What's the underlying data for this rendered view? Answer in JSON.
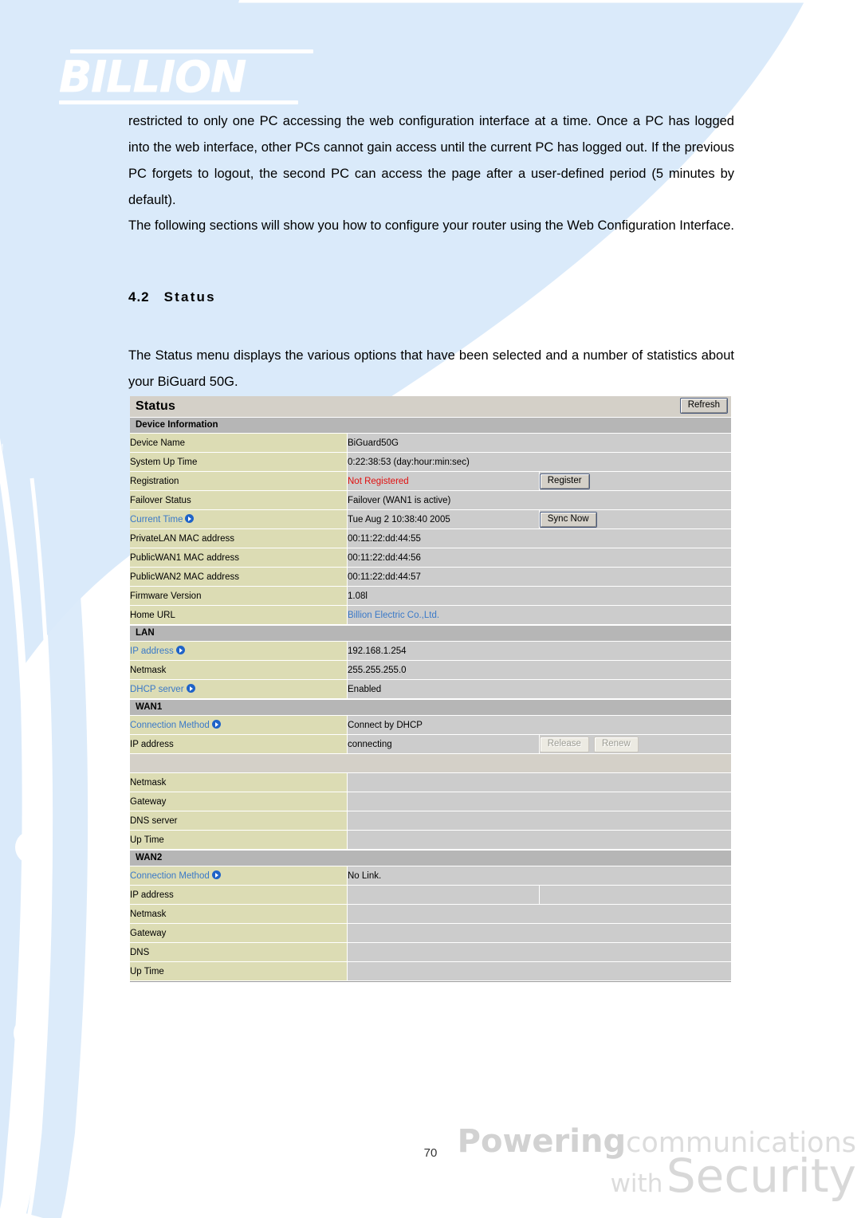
{
  "document": {
    "brand_logo_text": "BILLION",
    "page_number": "70",
    "footer": {
      "powering": "Powering",
      "communications": "communications",
      "with": "with",
      "security": "Security"
    },
    "paragraphs": {
      "p1": "restricted to only one PC accessing the web configuration interface at a time. Once a PC has logged into the web interface, other PCs cannot gain access until the current PC has logged out. If the previous PC forgets to logout, the second PC can access the page after a user-defined period (5 minutes by default).",
      "p2": "The following sections will show you how to configure your router using the Web Configuration Interface.",
      "p3": "The Status menu displays the various options that have been selected and a number of statistics about your BiGuard 50G."
    },
    "heading": {
      "number": "4.2",
      "title": "Status"
    }
  },
  "status_panel": {
    "title": "Status",
    "refresh_label": "Refresh",
    "sections": [
      {
        "name": "Device Information",
        "rows": [
          {
            "label": "Device Name",
            "value": "BiGuard50G"
          },
          {
            "label": "System Up Time",
            "value": "0:22:38:53 (day:hour:min:sec)"
          },
          {
            "label": "Registration",
            "value": "Not Registered",
            "value_style": "red",
            "button": "Register",
            "split": true
          },
          {
            "label": "Failover Status",
            "value": "Failover (WAN1 is active)"
          },
          {
            "label": "Current Time",
            "label_link": true,
            "value": "Tue Aug 2 10:38:40 2005",
            "button": "Sync Now",
            "split": true
          },
          {
            "label": "PrivateLAN MAC address",
            "value": "00:11:22:dd:44:55"
          },
          {
            "label": "PublicWAN1 MAC address",
            "value": "00:11:22:dd:44:56"
          },
          {
            "label": "PublicWAN2 MAC address",
            "value": "00:11:22:dd:44:57"
          },
          {
            "label": "Firmware Version",
            "value": "1.08l"
          },
          {
            "label": "Home URL",
            "value": "Billion Electric Co.,Ltd.",
            "value_style": "link"
          }
        ]
      },
      {
        "name": "LAN",
        "rows": [
          {
            "label": "IP address",
            "label_link": true,
            "value": "192.168.1.254"
          },
          {
            "label": "Netmask",
            "value": "255.255.255.0"
          },
          {
            "label": "DHCP server",
            "label_link": true,
            "value": "Enabled"
          }
        ]
      },
      {
        "name": "WAN1",
        "rows": [
          {
            "label": "Connection Method",
            "label_link": true,
            "value": "Connect by DHCP"
          },
          {
            "label": "IP address",
            "value": "connecting",
            "split": true,
            "buttons": [
              "Release",
              "Renew"
            ],
            "buttons_disabled": true
          },
          {
            "label": "Netmask",
            "value": ""
          },
          {
            "label": "Gateway",
            "value": ""
          },
          {
            "label": "DNS server",
            "value": ""
          },
          {
            "label": "Up Time",
            "value": ""
          }
        ]
      },
      {
        "name": "WAN2",
        "rows": [
          {
            "label": "Connection Method",
            "label_link": true,
            "value": "No Link."
          },
          {
            "label": "IP address",
            "value": "",
            "split": true
          },
          {
            "label": "Netmask",
            "value": ""
          },
          {
            "label": "Gateway",
            "value": ""
          },
          {
            "label": "DNS",
            "value": ""
          },
          {
            "label": "Up Time",
            "value": ""
          }
        ]
      }
    ]
  }
}
